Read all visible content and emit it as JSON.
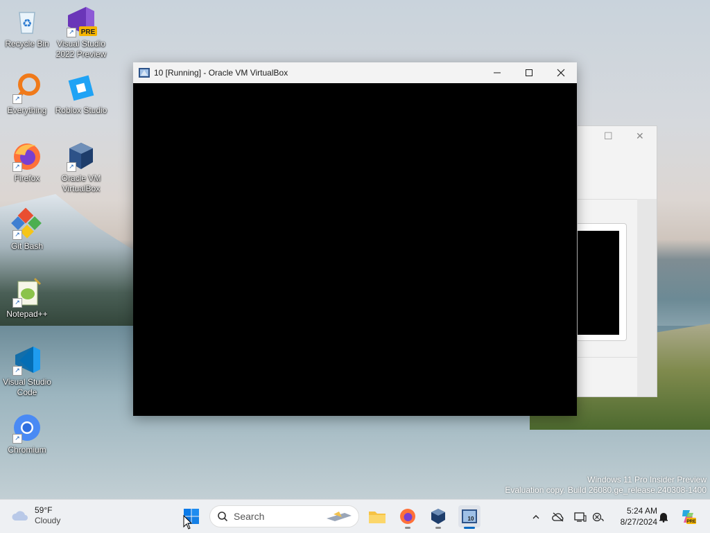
{
  "desktop": {
    "icons": [
      {
        "label": "Recycle Bin",
        "icon": "recycle-bin-icon"
      },
      {
        "label": "Visual Studio 2022 Preview",
        "icon": "visual-studio-preview-icon",
        "badge": "PRE"
      },
      {
        "label": "Everything",
        "icon": "everything-search-icon"
      },
      {
        "label": "Roblox Studio",
        "icon": "roblox-studio-icon"
      },
      {
        "label": "Firefox",
        "icon": "firefox-icon"
      },
      {
        "label": "Oracle VM VirtualBox",
        "icon": "virtualbox-icon"
      },
      {
        "label": "Git Bash",
        "icon": "git-bash-icon"
      },
      {
        "label": "Notepad++",
        "icon": "notepad-plus-plus-icon"
      },
      {
        "label": "Visual Studio Code",
        "icon": "vscode-icon"
      },
      {
        "label": "Chromium",
        "icon": "chromium-icon"
      }
    ]
  },
  "vm_window": {
    "title": "10 [Running] - Oracle VM VirtualBox",
    "controls": [
      "minimize",
      "maximize",
      "close"
    ]
  },
  "watermark": {
    "line1": "Windows 11 Pro Insider Preview",
    "line2": "Evaluation copy. Build 26080.ge_release.240308-1400"
  },
  "taskbar": {
    "weather": {
      "temp": "59°F",
      "condition": "Cloudy"
    },
    "search_placeholder": "Search",
    "apps": [
      "start",
      "file-explorer",
      "firefox",
      "virtualbox",
      "virtualbox-vm-10"
    ],
    "clock": {
      "time": "5:24 AM",
      "date": "8/27/2024"
    }
  },
  "colors": {
    "accent": "#0067c0",
    "taskbar": "#eef0f3",
    "titlebar": "#f3f3f3"
  }
}
